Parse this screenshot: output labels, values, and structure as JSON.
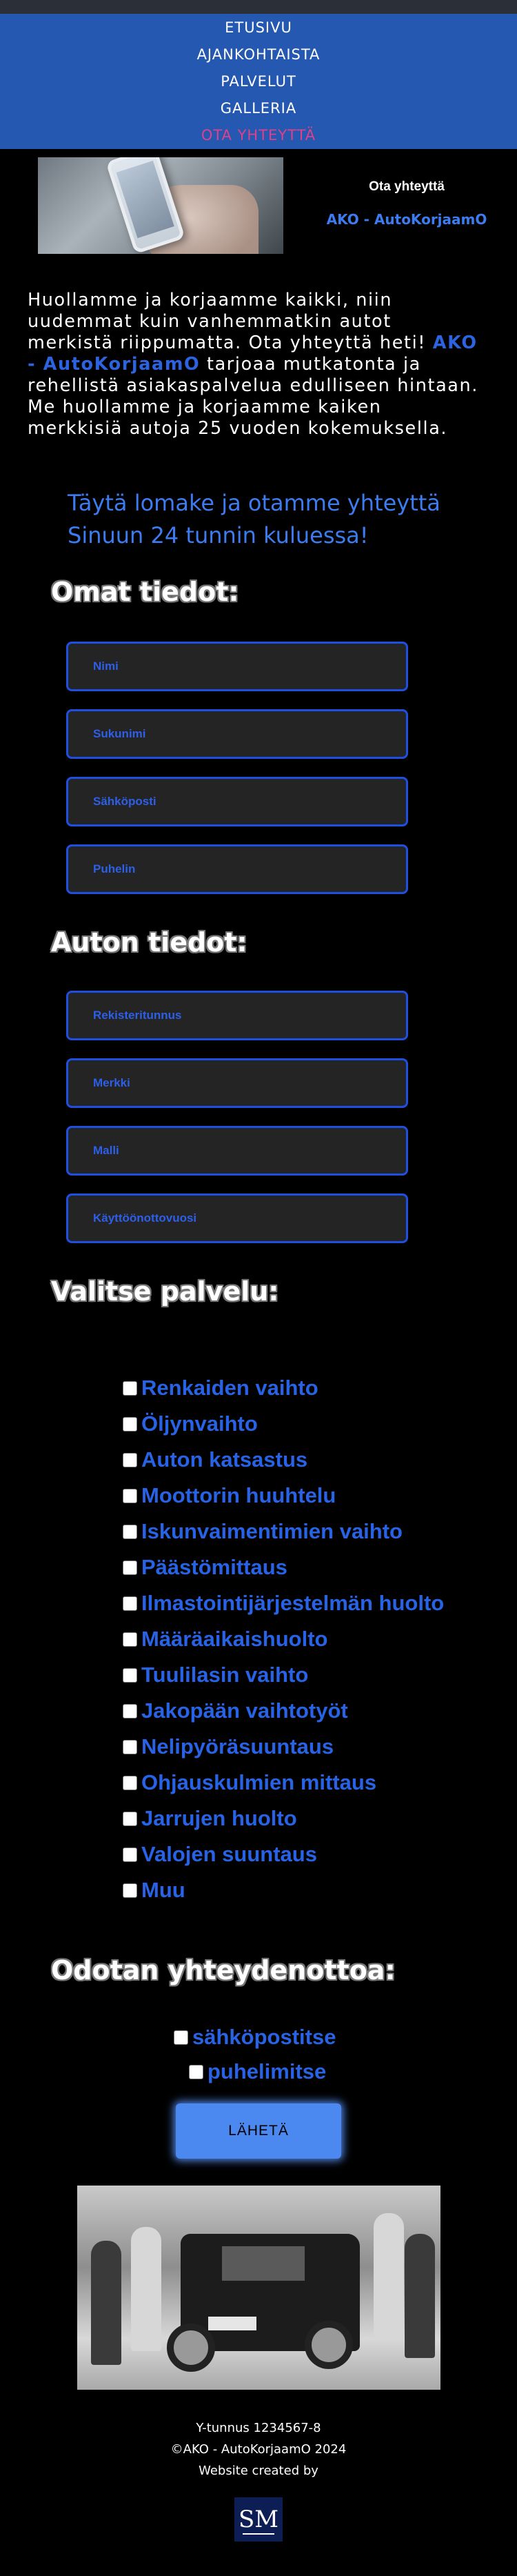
{
  "nav": {
    "items": [
      {
        "label": "ETUSIVU"
      },
      {
        "label": "AJANKOHTAISTA"
      },
      {
        "label": "PALVELUT"
      },
      {
        "label": "GALLERIA"
      },
      {
        "label": "OTA YHTEYTTÄ"
      }
    ]
  },
  "hero": {
    "title": "Ota yhteyttä",
    "brand": "AKO - AutoKorjaamO"
  },
  "intro": {
    "text_before": "Huollamme ja korjaamme kaikki, niin uudemmat kuin vanhemmatkin autot merkistä riippumatta. Ota yhteyttä heti! ",
    "brand": "AKO - AutoKorjaamO",
    "text_after": " tarjoaa mutkatonta ja rehellistä asiakaspalvelua edulliseen hintaan. Me huollamme ja korjaamme kaiken merkkisiä autoja 25 vuoden kokemuksella."
  },
  "callout": "Täytä lomake ja otamme yhteyttä Sinuun 24 tunnin kuluessa!",
  "personal": {
    "title": "Omat tiedot:",
    "fields": [
      {
        "placeholder": "Nimi"
      },
      {
        "placeholder": "Sukunimi"
      },
      {
        "placeholder": "Sähköposti"
      },
      {
        "placeholder": "Puhelin"
      }
    ]
  },
  "car": {
    "title": "Auton tiedot:",
    "fields": [
      {
        "placeholder": "Rekisteritunnus"
      },
      {
        "placeholder": "Merkki"
      },
      {
        "placeholder": "Malli"
      },
      {
        "placeholder": "Käyttöönottovuosi"
      }
    ]
  },
  "services": {
    "title": "Valitse palvelu:",
    "options": [
      {
        "label": "Renkaiden vaihto"
      },
      {
        "label": "Öljynvaihto"
      },
      {
        "label": "Auton katsastus"
      },
      {
        "label": "Moottorin huuhtelu"
      },
      {
        "label": "Iskunvaimentimien vaihto"
      },
      {
        "label": "Päästömittaus"
      },
      {
        "label": "Ilmastointijärjestelmän huolto"
      },
      {
        "label": "Määräaikaishuolto"
      },
      {
        "label": "Tuulilasin vaihto"
      },
      {
        "label": "Jakopään vaihtotyöt"
      },
      {
        "label": "Nelipyöräsuuntaus"
      },
      {
        "label": "Ohjauskulmien mittaus"
      },
      {
        "label": "Jarrujen huolto"
      },
      {
        "label": "Valojen suuntaus"
      },
      {
        "label": "Muu"
      }
    ]
  },
  "contact": {
    "title": "Odotan yhteydenottoa:",
    "options": [
      {
        "label": "sähköpostitse"
      },
      {
        "label": "puhelimitse"
      }
    ]
  },
  "submit_label": "LÄHETÄ",
  "footer": {
    "business_id": "Y-tunnus 1234567-8",
    "copyright": "©AKO - AutoKorjaamO 2024",
    "credit": "Website created by",
    "logo": "SM"
  },
  "colors": {
    "nav_bg": "#2558b0",
    "accent_blue": "#2863e6",
    "active_nav": "#e0408a",
    "page_bg": "#000000"
  }
}
